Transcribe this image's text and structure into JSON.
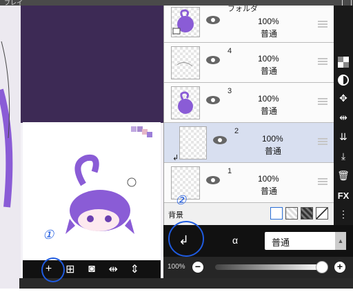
{
  "window": {
    "title_fragment": "ブレイ"
  },
  "layer_group": {
    "name": "フォルダ",
    "opacity": "100%",
    "blend": "普通"
  },
  "layers": [
    {
      "number": "4",
      "opacity": "100%",
      "blend": "普通"
    },
    {
      "number": "3",
      "opacity": "100%",
      "blend": "普通"
    },
    {
      "number": "2",
      "opacity": "100%",
      "blend": "普通",
      "selected": true,
      "clipping_arrow": "↲"
    },
    {
      "number": "1",
      "opacity": "100%",
      "blend": "普通"
    }
  ],
  "background_row": {
    "label": "背景"
  },
  "blend_mode": {
    "selected": "普通"
  },
  "opacity_slider": {
    "value_label": "100%",
    "value": 1.0
  },
  "preview_toolbar": [
    "add-layer",
    "add-image",
    "camera",
    "flip-horizontal",
    "flip-vertical"
  ],
  "right_tools": [
    "transparency-icon",
    "contrast-icon",
    "move-icon",
    "flip-horizontal-icon",
    "merge-down-icon",
    "download-icon",
    "trash-icon",
    "fx-icon",
    "more-icon"
  ],
  "right_tools_labels": {
    "fx": "FX",
    "more": "⋮"
  },
  "annotations": {
    "one": "①",
    "two": "②"
  },
  "colors": {
    "annotation": "#1f5be0",
    "selected_layer": "#d8dff0",
    "hair_purple": "#8a5cd6"
  }
}
